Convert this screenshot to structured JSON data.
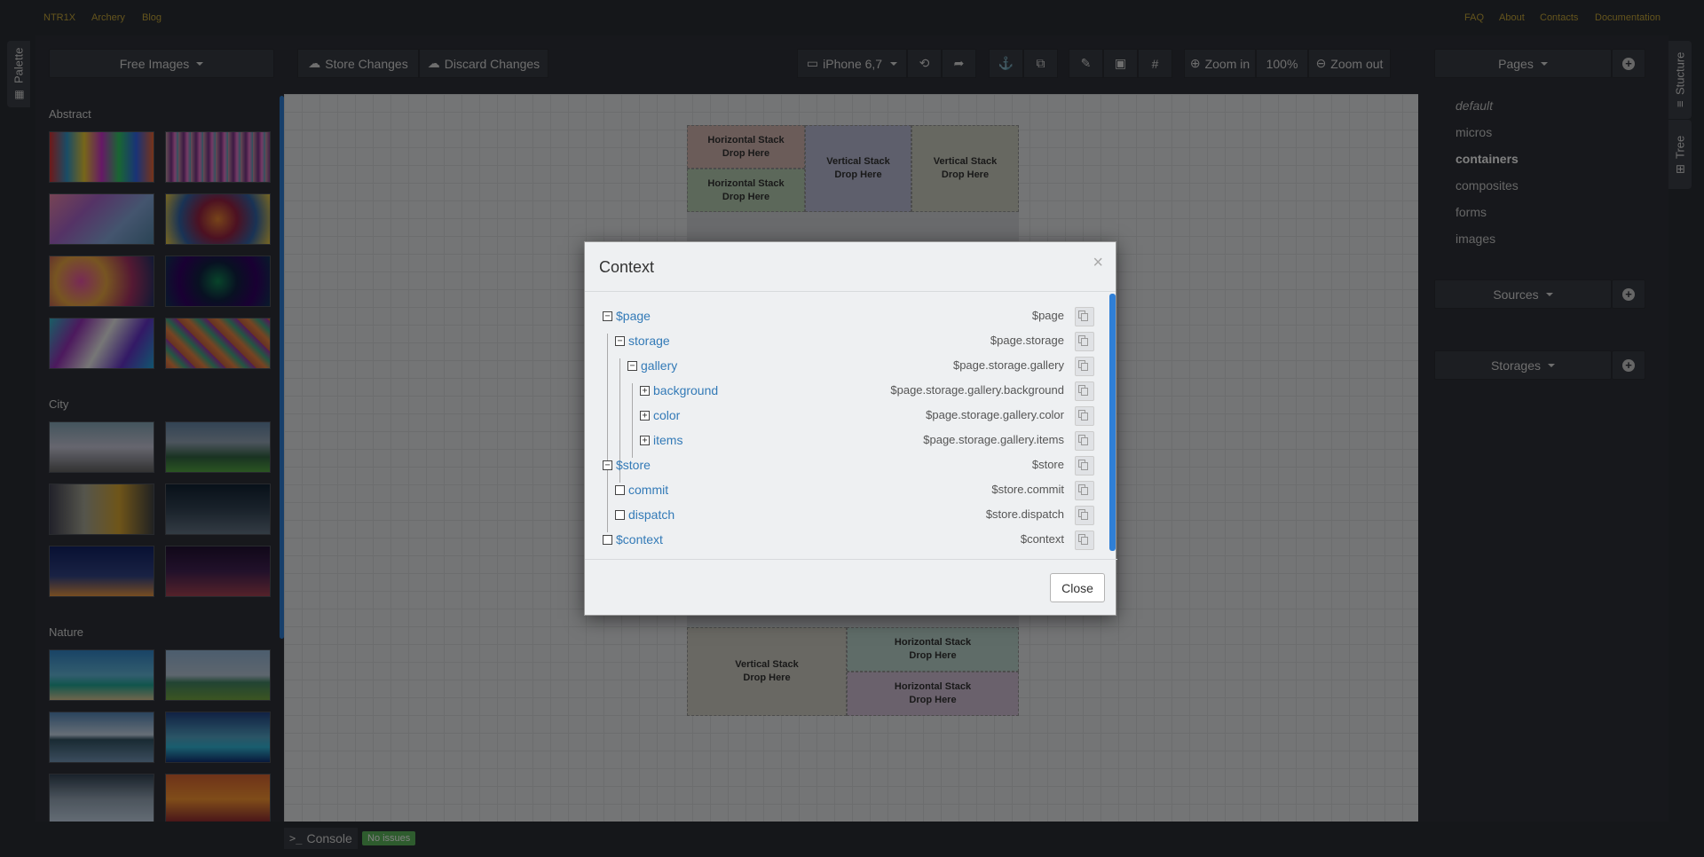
{
  "nav": {
    "left": [
      "NTR1X",
      "Archery",
      "Blog"
    ],
    "right": [
      "FAQ",
      "About",
      "Contacts",
      "Documentation"
    ]
  },
  "left_tabs": {
    "palette": "Palette"
  },
  "right_tabs": {
    "structure": "Stucture",
    "tree": "Tree"
  },
  "palette": {
    "dropdown": "Free Images",
    "categories": [
      "Abstract",
      "City",
      "Nature"
    ]
  },
  "toolbar": {
    "store": "Store Changes",
    "discard": "Discard Changes",
    "device": "iPhone 6,7",
    "zoom_in": "Zoom in",
    "zoom_level": "100%",
    "zoom_out": "Zoom out"
  },
  "canvas": {
    "cells": [
      {
        "title": "Horizontal Stack",
        "sub": "Drop Here"
      },
      {
        "title": "Horizontal Stack",
        "sub": "Drop Here"
      },
      {
        "title": "Vertical Stack",
        "sub": "Drop Here"
      },
      {
        "title": "Vertical Stack",
        "sub": "Drop Here"
      },
      {
        "title": "Vertical Stack",
        "sub": "Drop Here"
      },
      {
        "title": "Horizontal Stack",
        "sub": "Drop Here"
      },
      {
        "title": "Horizontal Stack",
        "sub": "Drop Here"
      }
    ]
  },
  "right_panel": {
    "pages_label": "Pages",
    "pages": [
      "default",
      "micros",
      "containers",
      "composites",
      "forms",
      "images"
    ],
    "active_page": "containers",
    "sources_label": "Sources",
    "storages_label": "Storages"
  },
  "bottom": {
    "console": "Console",
    "status": "No issues"
  },
  "modal": {
    "title": "Context",
    "close_x": "×",
    "close_button": "Close",
    "tree": [
      {
        "label": "$page",
        "path": "$page",
        "toggle": "−"
      },
      {
        "label": "storage",
        "path": "$page.storage",
        "toggle": "−"
      },
      {
        "label": "gallery",
        "path": "$page.storage.gallery",
        "toggle": "−"
      },
      {
        "label": "background",
        "path": "$page.storage.gallery.background",
        "toggle": "+"
      },
      {
        "label": "color",
        "path": "$page.storage.gallery.color",
        "toggle": "+"
      },
      {
        "label": "items",
        "path": "$page.storage.gallery.items",
        "toggle": "+"
      },
      {
        "label": "$store",
        "path": "$store",
        "toggle": "−"
      },
      {
        "label": "commit",
        "path": "$store.commit",
        "toggle": ""
      },
      {
        "label": "dispatch",
        "path": "$store.dispatch",
        "toggle": ""
      },
      {
        "label": "$context",
        "path": "$context",
        "toggle": ""
      }
    ]
  },
  "colors": {
    "accent": "#2f7fd6",
    "nav_link": "#c8a93a",
    "link": "#337ab7",
    "badge": "#5cb85c"
  }
}
